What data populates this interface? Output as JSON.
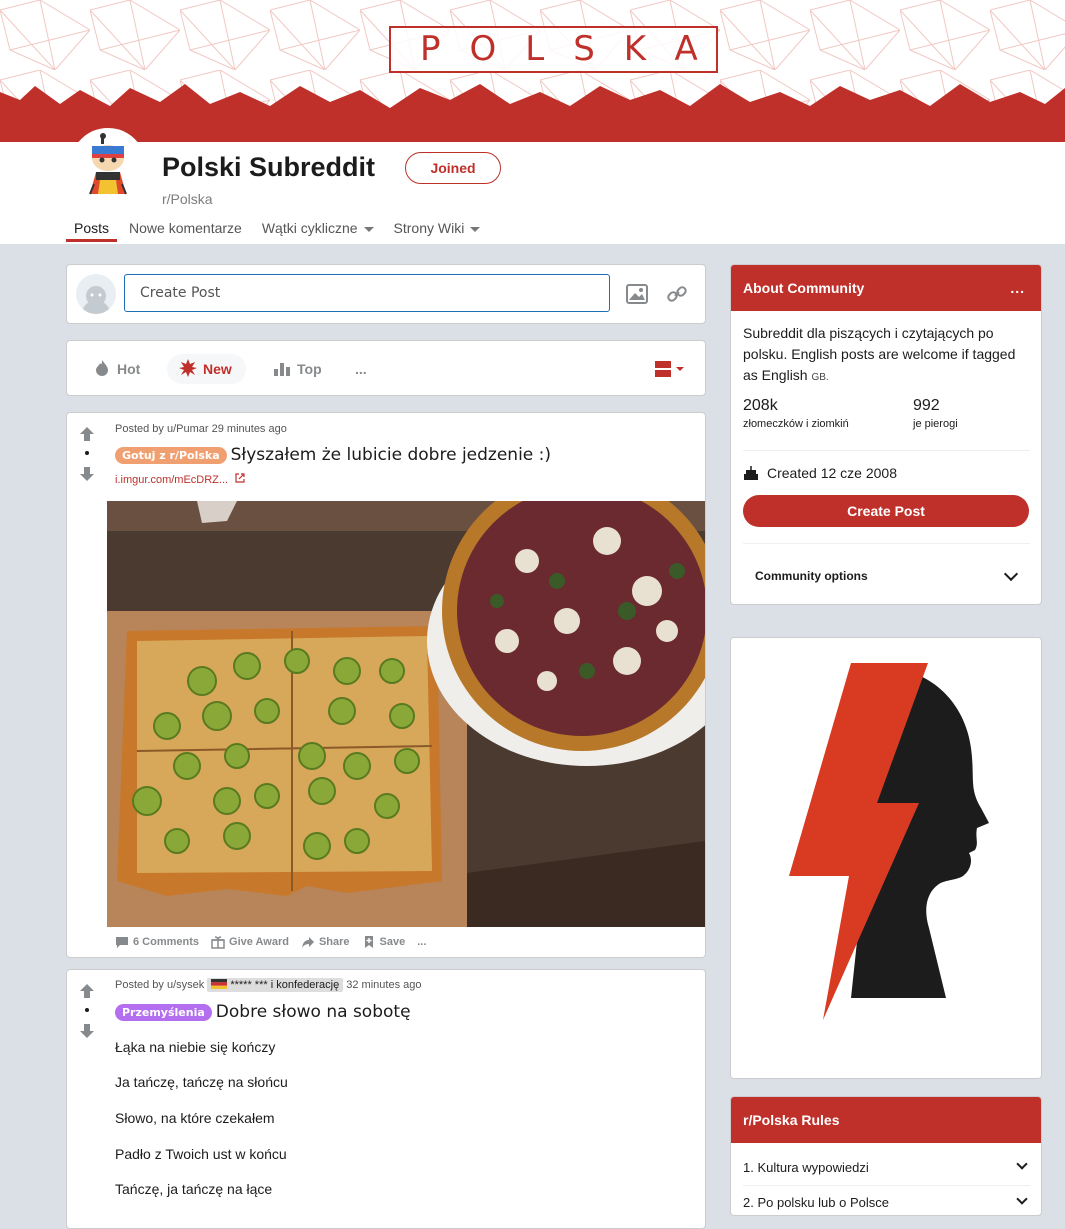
{
  "banner": {
    "title": "POLSKA"
  },
  "header": {
    "title": "Polski Subreddit",
    "subname": "r/Polska",
    "joined_label": "Joined"
  },
  "tabs": [
    {
      "label": "Posts",
      "active": true
    },
    {
      "label": "Nowe komentarze"
    },
    {
      "label": "Wątki cykliczne",
      "dropdown": true
    },
    {
      "label": "Strony Wiki",
      "dropdown": true
    }
  ],
  "create_post": {
    "placeholder": "Create Post"
  },
  "sort": {
    "hot": "Hot",
    "new": "New",
    "top": "Top",
    "more": "..."
  },
  "posts": [
    {
      "posted_by": "Posted by u/Pumar",
      "time": "29 minutes ago",
      "flair": "Gotuj z r/Polska",
      "flair_color": "#f0a070",
      "title": "Słyszałem że lubicie dobre jedzenie :)",
      "link": "i.imgur.com/mEcDRZ...",
      "comments": "6 Comments",
      "award": "Give Award",
      "share": "Share",
      "save": "Save",
      "more": "..."
    },
    {
      "posted_by": "Posted by u/sysek",
      "user_flair": "***** *** i konfederację",
      "time": "32 minutes ago",
      "flair": "Przemyślenia",
      "flair_color": "#b46ff0",
      "title": "Dobre słowo na sobotę",
      "lines": [
        "Łąka na niebie się kończy",
        "Ja tańczę, tańczę na słońcu",
        "Słowo, na które czekałem",
        "Padło z Twoich ust w końcu",
        "Tańczę, ja tańczę na łące"
      ]
    }
  ],
  "about": {
    "title": "About Community",
    "more": "...",
    "desc": "Subreddit dla piszących i czytających po polsku. English posts are welcome if tagged as English",
    "desc_tag": "GB.",
    "members": "208k",
    "members_label": "złomeczków i ziomkiń",
    "online": "992",
    "online_label": "je pierogi",
    "created": "Created 12 cze 2008",
    "create_post": "Create Post",
    "options": "Community options"
  },
  "rules": {
    "title": "r/Polska Rules",
    "items": [
      "1. Kultura wypowiedzi",
      "2. Po polsku lub o Polsce"
    ]
  },
  "colors": {
    "brand": "#c0302a",
    "background": "#dae0e6"
  }
}
